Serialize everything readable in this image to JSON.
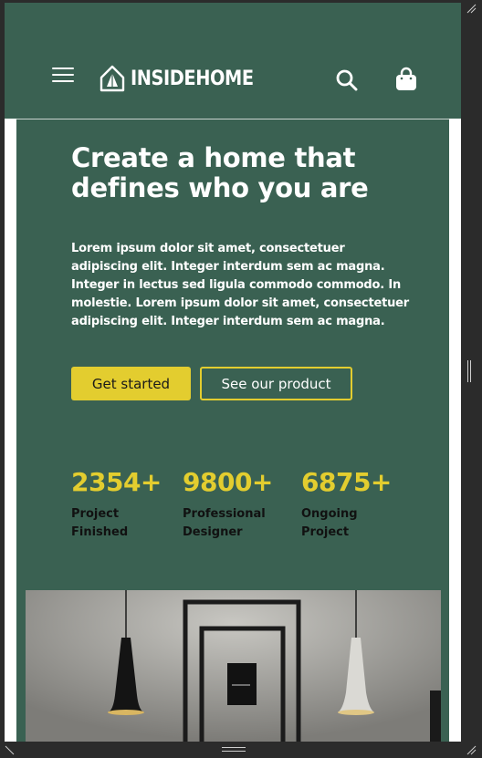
{
  "header": {
    "brand": "INSIDEHOME",
    "menu_icon": "hamburger-menu-icon",
    "logo_icon": "house-logo-icon",
    "search_icon": "search-icon",
    "cart_icon": "shopping-bag-icon"
  },
  "hero": {
    "title": "Create a home that defines who you are",
    "description": "Lorem ipsum dolor sit amet, consectetuer adipiscing elit. Integer interdum sem ac magna. Integer in lectus sed ligula commodo commodo. In molestie. Lorem ipsum dolor sit amet, consectetuer adipiscing elit. Integer interdum sem ac magna.",
    "primary_button": "Get started",
    "secondary_button": "See our product"
  },
  "stats": [
    {
      "value": "2354+",
      "label": "Project Finished"
    },
    {
      "value": "9800+",
      "label": "Professional Designer"
    },
    {
      "value": "6875+",
      "label": "Ongoing Project"
    }
  ],
  "colors": {
    "brand_green": "#3a6152",
    "accent_yellow": "#e3cd2f",
    "frame": "#2b2b2b"
  }
}
